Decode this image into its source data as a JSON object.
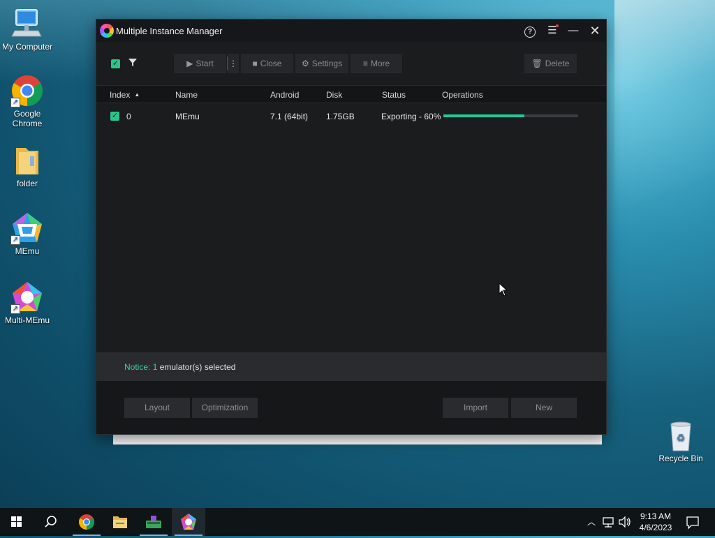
{
  "desktop": {
    "icons": [
      {
        "label": "My Computer"
      },
      {
        "label": "Google Chrome"
      },
      {
        "label": "folder"
      },
      {
        "label": "MEmu"
      },
      {
        "label": "Multi-MEmu"
      },
      {
        "label": "Recycle Bin"
      }
    ]
  },
  "window": {
    "title": "Multiple Instance Manager",
    "toolbar": {
      "start_label": "Start",
      "close_label": "Close",
      "settings_label": "Settings",
      "more_label": "More",
      "delete_label": "Delete"
    },
    "table": {
      "headers": [
        "Index",
        "Name",
        "Android",
        "Disk",
        "Status",
        "Operations"
      ],
      "rows": [
        {
          "checked": true,
          "index": "0",
          "name": "MEmu",
          "android": "7.1 (64bit)",
          "disk": "1.75GB",
          "status": "Exporting - 60%",
          "progress": 0.6
        }
      ]
    },
    "notice": {
      "prefix": "Notice: ",
      "count": "1",
      "suffix": " emulator(s) selected"
    },
    "bottom_buttons": {
      "layout": "Layout",
      "optimization": "Optimization",
      "import": "Import",
      "new": "New"
    }
  },
  "taskbar": {
    "time": "9:13 AM",
    "date": "4/6/2023"
  },
  "colors": {
    "accent_green": "#22c792",
    "window_bg": "#1b1c1e",
    "notice_green": "#3fd39c"
  }
}
